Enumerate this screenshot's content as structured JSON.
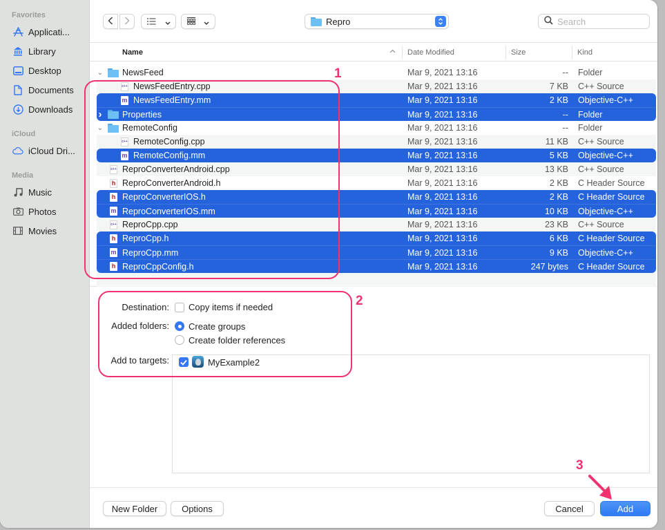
{
  "sidebar": {
    "sections": [
      {
        "title": "Favorites",
        "items": [
          {
            "label": "Applicati...",
            "icon": "applications-icon"
          },
          {
            "label": "Library",
            "icon": "library-icon"
          },
          {
            "label": "Desktop",
            "icon": "desktop-icon"
          },
          {
            "label": "Documents",
            "icon": "document-icon"
          },
          {
            "label": "Downloads",
            "icon": "downloads-icon"
          }
        ]
      },
      {
        "title": "iCloud",
        "items": [
          {
            "label": "iCloud Dri...",
            "icon": "cloud-icon"
          }
        ]
      },
      {
        "title": "Media",
        "items": [
          {
            "label": "Music",
            "icon": "music-note-icon"
          },
          {
            "label": "Photos",
            "icon": "camera-icon"
          },
          {
            "label": "Movies",
            "icon": "film-icon"
          }
        ]
      }
    ]
  },
  "toolbar": {
    "back_icon": "chevron-left-icon",
    "forward_icon": "chevron-right-icon",
    "view_list_icon": "list-view-icon",
    "group_icon": "grid-view-icon",
    "location": "Repro",
    "search_placeholder": "Search"
  },
  "columns": {
    "name": "Name",
    "date": "Date Modified",
    "size": "Size",
    "kind": "Kind"
  },
  "files": [
    {
      "name": "NewsFeed",
      "type": "folder",
      "indent": 0,
      "disclosure": "expanded",
      "date": "Mar 9, 2021 13:16",
      "size": "--",
      "kind": "Folder",
      "selected": false
    },
    {
      "name": "NewsFeedEntry.cpp",
      "type": "cpp",
      "indent": 1,
      "date": "Mar 9, 2021 13:16",
      "size": "7 KB",
      "kind": "C++ Source",
      "selected": false
    },
    {
      "name": "NewsFeedEntry.mm",
      "type": "mm",
      "indent": 1,
      "date": "Mar 9, 2021 13:16",
      "size": "2 KB",
      "kind": "Objective-C++",
      "selected": true
    },
    {
      "name": "Properties",
      "type": "folder",
      "indent": 0,
      "disclosure": "collapsed",
      "date": "Mar 9, 2021 13:16",
      "size": "--",
      "kind": "Folder",
      "selected": true
    },
    {
      "name": "RemoteConfig",
      "type": "folder",
      "indent": 0,
      "disclosure": "expanded",
      "date": "Mar 9, 2021 13:16",
      "size": "--",
      "kind": "Folder",
      "selected": false
    },
    {
      "name": "RemoteConfig.cpp",
      "type": "cpp",
      "indent": 1,
      "date": "Mar 9, 2021 13:16",
      "size": "11 KB",
      "kind": "C++ Source",
      "selected": false
    },
    {
      "name": "RemoteConfig.mm",
      "type": "mm",
      "indent": 1,
      "date": "Mar 9, 2021 13:16",
      "size": "5 KB",
      "kind": "Objective-C++",
      "selected": true
    },
    {
      "name": "ReproConverterAndroid.cpp",
      "type": "cpp",
      "indent": 0,
      "date": "Mar 9, 2021 13:16",
      "size": "13 KB",
      "kind": "C++ Source",
      "selected": false
    },
    {
      "name": "ReproConverterAndroid.h",
      "type": "h",
      "indent": 0,
      "date": "Mar 9, 2021 13:16",
      "size": "2 KB",
      "kind": "C Header Source",
      "selected": false
    },
    {
      "name": "ReproConverterIOS.h",
      "type": "h",
      "indent": 0,
      "date": "Mar 9, 2021 13:16",
      "size": "2 KB",
      "kind": "C Header Source",
      "selected": true
    },
    {
      "name": "ReproConverterIOS.mm",
      "type": "mm",
      "indent": 0,
      "date": "Mar 9, 2021 13:16",
      "size": "10 KB",
      "kind": "Objective-C++",
      "selected": true
    },
    {
      "name": "ReproCpp.cpp",
      "type": "cpp",
      "indent": 0,
      "date": "Mar 9, 2021 13:16",
      "size": "23 KB",
      "kind": "C++ Source",
      "selected": false
    },
    {
      "name": "ReproCpp.h",
      "type": "h",
      "indent": 0,
      "date": "Mar 9, 2021 13:16",
      "size": "6 KB",
      "kind": "C Header Source",
      "selected": true
    },
    {
      "name": "ReproCpp.mm",
      "type": "mm",
      "indent": 0,
      "date": "Mar 9, 2021 13:16",
      "size": "9 KB",
      "kind": "Objective-C++",
      "selected": true
    },
    {
      "name": "ReproCppConfig.h",
      "type": "h",
      "indent": 0,
      "date": "Mar 9, 2021 13:16",
      "size": "247 bytes",
      "kind": "C Header Source",
      "selected": true
    }
  ],
  "options": {
    "destination_label": "Destination:",
    "copy_items_label": "Copy items if needed",
    "copy_items_checked": false,
    "added_folders_label": "Added folders:",
    "create_groups_label": "Create groups",
    "create_folder_refs_label": "Create folder references",
    "selected_folder_option": "Create groups",
    "add_to_targets_label": "Add to targets:",
    "targets": [
      {
        "name": "MyExample2",
        "checked": true
      }
    ]
  },
  "footer": {
    "new_folder": "New Folder",
    "options": "Options",
    "cancel": "Cancel",
    "add": "Add"
  },
  "annotations": {
    "one": "1",
    "two": "2",
    "three": "3",
    "color": "#f0336e"
  },
  "colors": {
    "selection": "#2563dc",
    "accent": "#3478f6"
  }
}
